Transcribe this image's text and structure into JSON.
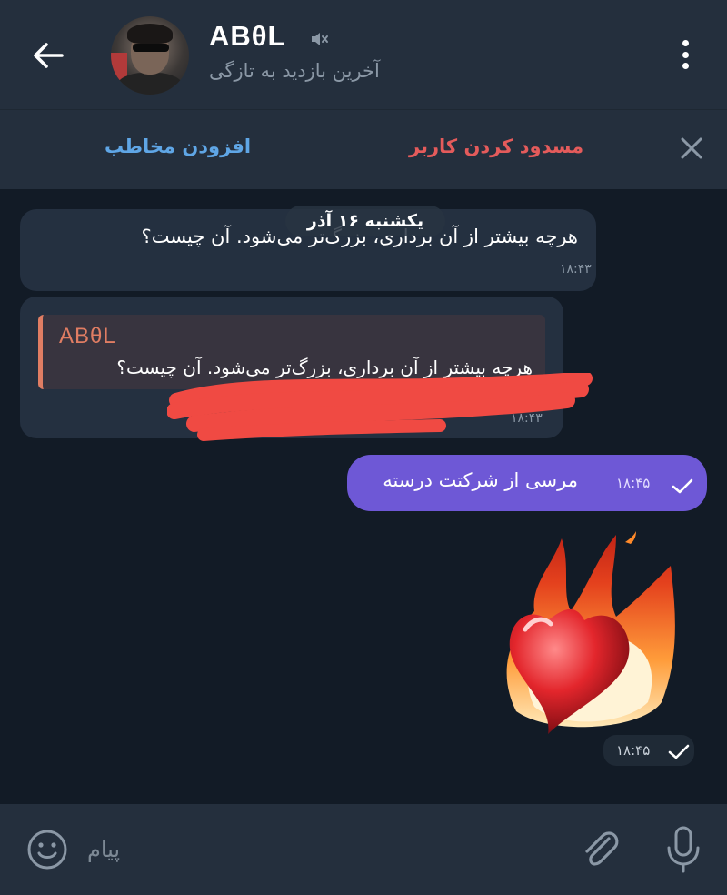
{
  "header": {
    "contact_name": "ABθL",
    "status": "آخرین بازدید به تازگی",
    "icons": [
      "arrow-left-icon",
      "mute-icon",
      "more-vertical-icon"
    ]
  },
  "actionbar": {
    "add_contact": "افزودن مخاطب",
    "block_user": "مسدود کردن کاربر",
    "close_icon": "close-icon"
  },
  "chat": {
    "date_label": "یکشنبه ۱۶ آذر",
    "messages": [
      {
        "direction": "incoming",
        "text": "هرچه بیشتر از آن برداری، بزرگ‌تر می‌شود. آن چیست؟",
        "time": "۱۸:۴۳"
      },
      {
        "direction": "incoming",
        "reply_to": {
          "name": "ABθL",
          "text": "هرچه بیشتر از آن برداری، بزرگ‌تر می‌شود. آن چیست؟"
        },
        "time": "۱۸:۴۳",
        "redacted": true
      },
      {
        "direction": "outgoing",
        "text": "مرسی از شرکتت درسته",
        "time": "۱۸:۴۵",
        "status_icon": "check-icon"
      },
      {
        "direction": "outgoing",
        "sticker": "heart-on-fire-icon",
        "time": "۱۸:۴۵",
        "status_icon": "check-icon"
      }
    ]
  },
  "inputbar": {
    "placeholder": "پیام",
    "icons": [
      "emoji-icon",
      "paperclip-icon",
      "microphone-icon"
    ]
  },
  "colors": {
    "background": "#17212b",
    "header": "#242f3d",
    "incoming_bubble": "#243040",
    "outgoing_bubble": "#6e58d6",
    "link_blue": "#5fa6e6",
    "danger_red": "#e45b5b",
    "reply_accent": "#e07d63"
  }
}
